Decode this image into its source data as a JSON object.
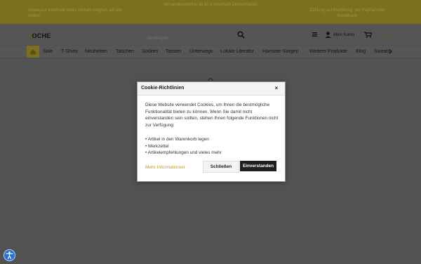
{
  "topbar": {
    "promo_left": "Umtausch innerhalb eines Monats möglich auf alle Artikel",
    "promo_center": "Versandkostenfrei ab 50 € innerhalb Deutschlands",
    "promo_right": "Zahlung auf Rechnung, per PayPal oder Kreditkarte"
  },
  "header": {
    "logo_icon": "heart",
    "logo_text": "OCHE",
    "search_placeholder": "Suchbegriff...",
    "account_label": "Mein Konto",
    "cart_amount": "0,00 €"
  },
  "nav": {
    "home_icon": "home",
    "items": [
      "Sale",
      "T-Shirts",
      "Neuheiten",
      "Taschen",
      "Socken",
      "Tassen",
      "Unterwegs",
      "Lokale Literatur",
      "Hamster-Sorgen",
      "Weitere Produkte",
      "Blog",
      "Sweats"
    ]
  },
  "cookie_modal": {
    "title": "Cookie-Richtlinien",
    "close_symbol": "×",
    "body_text": "Diese Website verwendet Cookies, um Ihnen die bestmögliche Funktionalität bieten zu können. Wenn Sie damit nicht einverstanden sein sollten, stehen Ihnen folgende Funktionen nicht zur Verfügung:",
    "items": [
      "Artikel in den Warenkorb legen",
      "Merkzettel",
      "Artikelempfehlungen und vieles mehr"
    ],
    "more_info": "Mehr Informationen",
    "button_close": "Schließen",
    "button_agree": "Einverstanden"
  },
  "accessibility": {
    "icon": "accessibility"
  },
  "colors": {
    "brand": "#7c6f1f",
    "accent": "#c59a2e",
    "overlay": "#525252",
    "button_dark": "#1f1f1f"
  }
}
